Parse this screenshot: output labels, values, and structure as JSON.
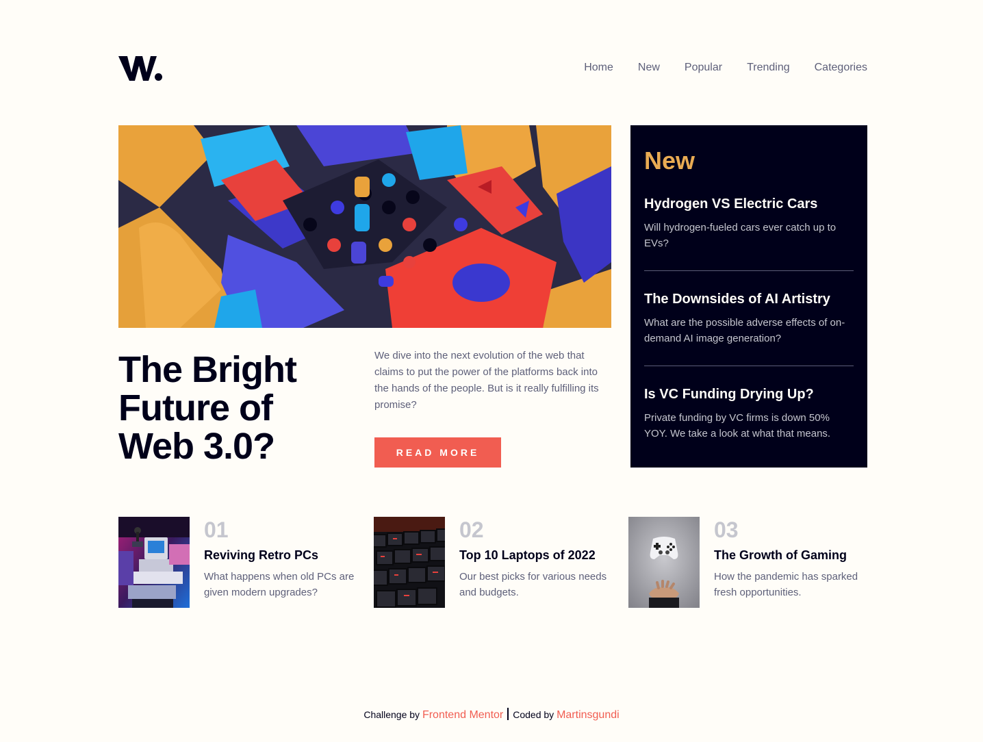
{
  "brand": {
    "logo_alt": "W."
  },
  "nav": {
    "items": [
      {
        "label": "Home"
      },
      {
        "label": "New"
      },
      {
        "label": "Popular"
      },
      {
        "label": "Trending"
      },
      {
        "label": "Categories"
      }
    ]
  },
  "hero": {
    "title": "The Bright Future of Web 3.0?",
    "description": "We dive into the next evolution of the web that claims to put the power of the platforms back into the hands of the people. But is it really fulfilling its promise?",
    "button_label": "READ MORE"
  },
  "new_panel": {
    "heading": "New",
    "items": [
      {
        "title": "Hydrogen VS Electric Cars",
        "description": "Will hydrogen-fueled cars ever catch up to EVs?"
      },
      {
        "title": "The Downsides of AI Artistry",
        "description": "What are the possible adverse effects of on-demand AI image generation?"
      },
      {
        "title": "Is VC Funding Drying Up?",
        "description": "Private funding by VC firms is down 50% YOY. We take a look at what that means."
      }
    ]
  },
  "cards": [
    {
      "number": "01",
      "title": "Reviving Retro PCs",
      "description": "What happens when old PCs are given modern upgrades?"
    },
    {
      "number": "02",
      "title": "Top 10 Laptops of 2022",
      "description": "Our best picks for various needs and budgets."
    },
    {
      "number": "03",
      "title": "The Growth of Gaming",
      "description": "How the pandemic has sparked fresh opportunities."
    }
  ],
  "attribution": {
    "prefix": "Challenge by",
    "challenge_link": "Frontend Mentor",
    "middle": "Coded by",
    "author_link": "Martinsgundi"
  },
  "colors": {
    "accent_red": "#f15d51",
    "accent_orange": "#e9ab53",
    "dark_navy": "#00001a",
    "grayish_blue": "#5d5f79",
    "off_white": "#fffdf8"
  }
}
